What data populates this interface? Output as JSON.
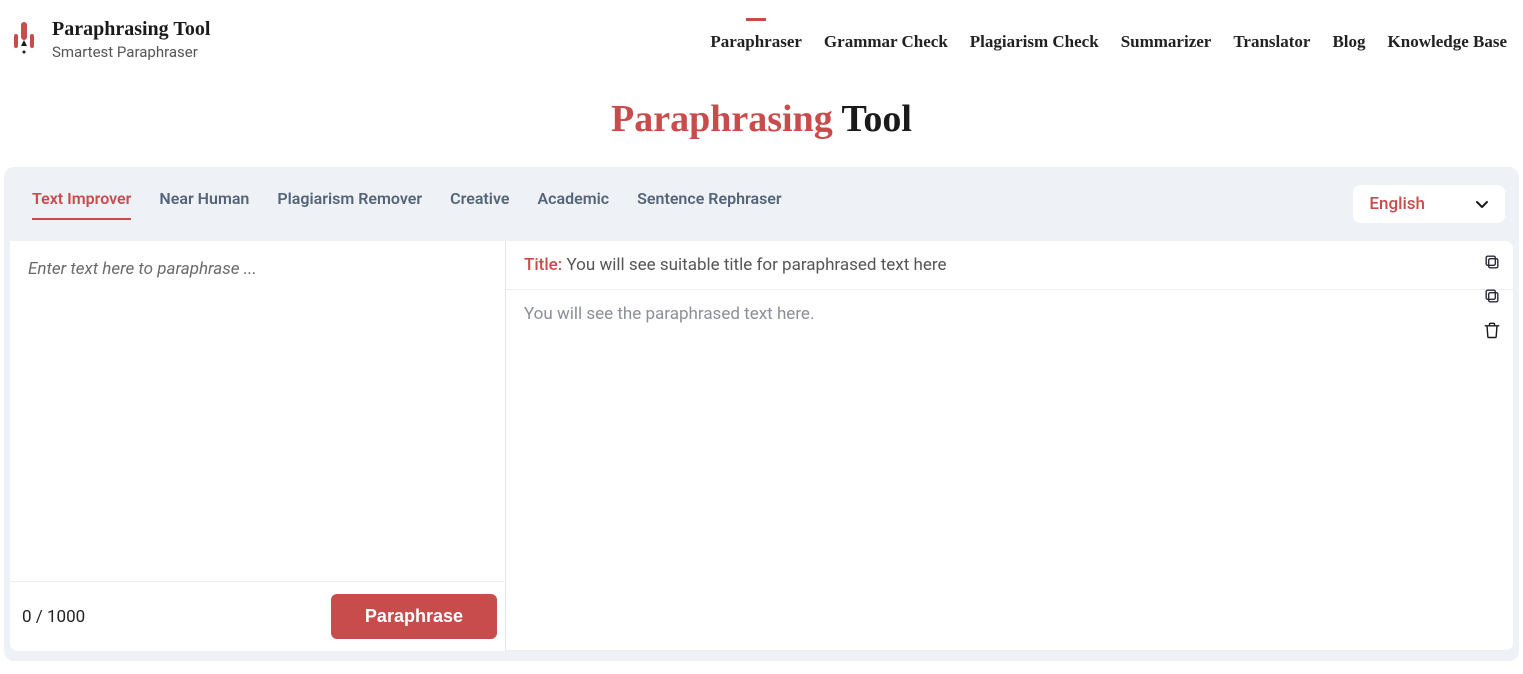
{
  "brand": {
    "title": "Paraphrasing Tool",
    "subtitle": "Smartest Paraphraser"
  },
  "nav": [
    "Paraphraser",
    "Grammar Check",
    "Plagiarism Check",
    "Summarizer",
    "Translator",
    "Blog",
    "Knowledge Base"
  ],
  "nav_active_index": 0,
  "page_heading": {
    "accent": "Paraphrasing",
    "plain": " Tool"
  },
  "modes": [
    "Text Improver",
    "Near Human",
    "Plagiarism Remover",
    "Creative",
    "Academic",
    "Sentence Rephraser"
  ],
  "mode_active_index": 0,
  "language": "English",
  "input_placeholder": "Enter text here to paraphrase ...",
  "counter": "0 / 1000",
  "paraphrase_button": "Paraphrase",
  "output": {
    "title_label": "Title:",
    "title_placeholder": "You will see suitable title for paraphrased text here",
    "body_placeholder": "You will see the paraphrased text here."
  },
  "colors": {
    "accent": "#c94c4c",
    "panel_bg": "#eef2f6"
  }
}
